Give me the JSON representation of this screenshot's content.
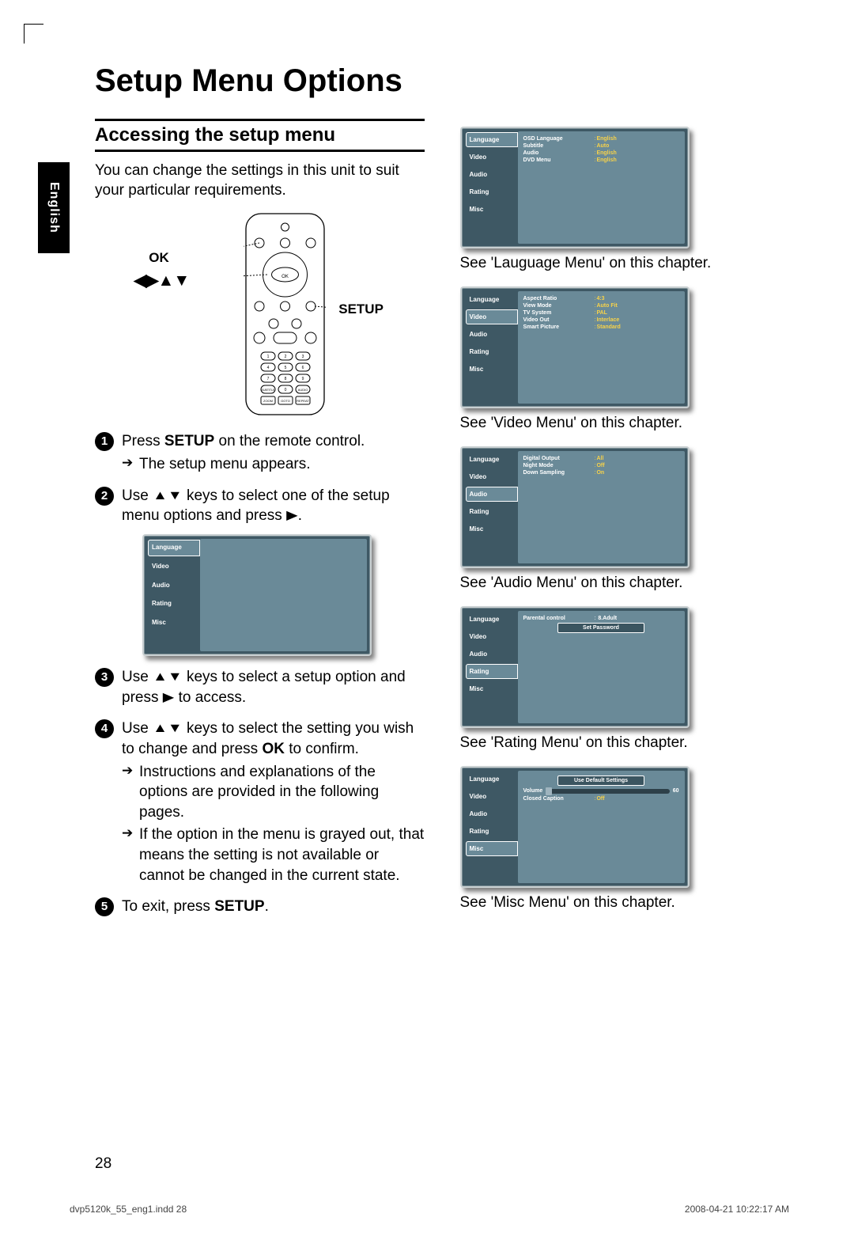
{
  "side_tab": "English",
  "title": "Setup Menu Options",
  "subheading": "Accessing the setup menu",
  "intro": "You can change the settings in this unit to suit your particular requirements.",
  "remote_labels": {
    "ok": "OK",
    "setup": "SETUP"
  },
  "steps": {
    "s1_a": "Press ",
    "s1_b": "SETUP",
    "s1_c": " on the remote control.",
    "s1_sub": "The setup menu appears.",
    "s2_a": "Use ",
    "s2_b": " keys to select one of the setup menu options and press ",
    "s2_c": ".",
    "s3_a": "Use ",
    "s3_b": " keys to select a setup option and press ",
    "s3_c": " to access.",
    "s4_a": "Use ",
    "s4_b": " keys to select the setting you wish to change and press ",
    "s4_c": "OK",
    "s4_d": " to confirm.",
    "s4_sub1": "Instructions and explanations of the options are provided in the following pages.",
    "s4_sub2": "If the option in the menu is grayed out, that means the setting is not available or cannot be changed in the current state.",
    "s5_a": "To exit, press ",
    "s5_b": "SETUP",
    "s5_c": "."
  },
  "osd_tabs": [
    "Language",
    "Video",
    "Audio",
    "Rating",
    "Misc"
  ],
  "osd_language": {
    "rows": [
      {
        "lbl": "OSD Language",
        "val": "English",
        "hi": true
      },
      {
        "lbl": "Subtitle",
        "val": "Auto",
        "hi": true
      },
      {
        "lbl": "Audio",
        "val": "English",
        "hi": true
      },
      {
        "lbl": "DVD Menu",
        "val": "English",
        "hi": true
      }
    ],
    "caption": "See 'Lauguage Menu' on this chapter."
  },
  "osd_video": {
    "rows": [
      {
        "lbl": "Aspect Ratio",
        "val": "4:3",
        "hi": true
      },
      {
        "lbl": "View Mode",
        "val": "Auto Fit",
        "hi": true
      },
      {
        "lbl": "TV System",
        "val": "PAL",
        "hi": true
      },
      {
        "lbl": "Video Out",
        "val": "Interlace",
        "hi": true
      },
      {
        "lbl": "Smart Picture",
        "val": "Standard",
        "hi": true
      }
    ],
    "caption": "See 'Video Menu' on this chapter."
  },
  "osd_audio": {
    "rows": [
      {
        "lbl": "Digital Output",
        "val": "All",
        "hi": true
      },
      {
        "lbl": "Night  Mode",
        "val": "Off",
        "hi": true
      },
      {
        "lbl": "Down Sampling",
        "val": "On",
        "hi": true
      }
    ],
    "caption": "See 'Audio Menu' on this chapter."
  },
  "osd_rating": {
    "rows": [
      {
        "lbl": "Parental control",
        "val": "8.Adult",
        "hi": false
      }
    ],
    "buttons": [
      "Set Password"
    ],
    "caption": "See 'Rating Menu' on this chapter."
  },
  "osd_misc": {
    "buttons": [
      "Use Default Settings"
    ],
    "slider": {
      "lbl": "Volume",
      "val": "60"
    },
    "rows": [
      {
        "lbl": "Closed Caption",
        "val": "Off",
        "hi": true
      }
    ],
    "caption": "See 'Misc Menu' on this chapter."
  },
  "page_num": "28",
  "footer": {
    "file": "dvp5120k_55_eng1.indd   28",
    "stamp": "2008-04-21   10:22:17 AM"
  }
}
